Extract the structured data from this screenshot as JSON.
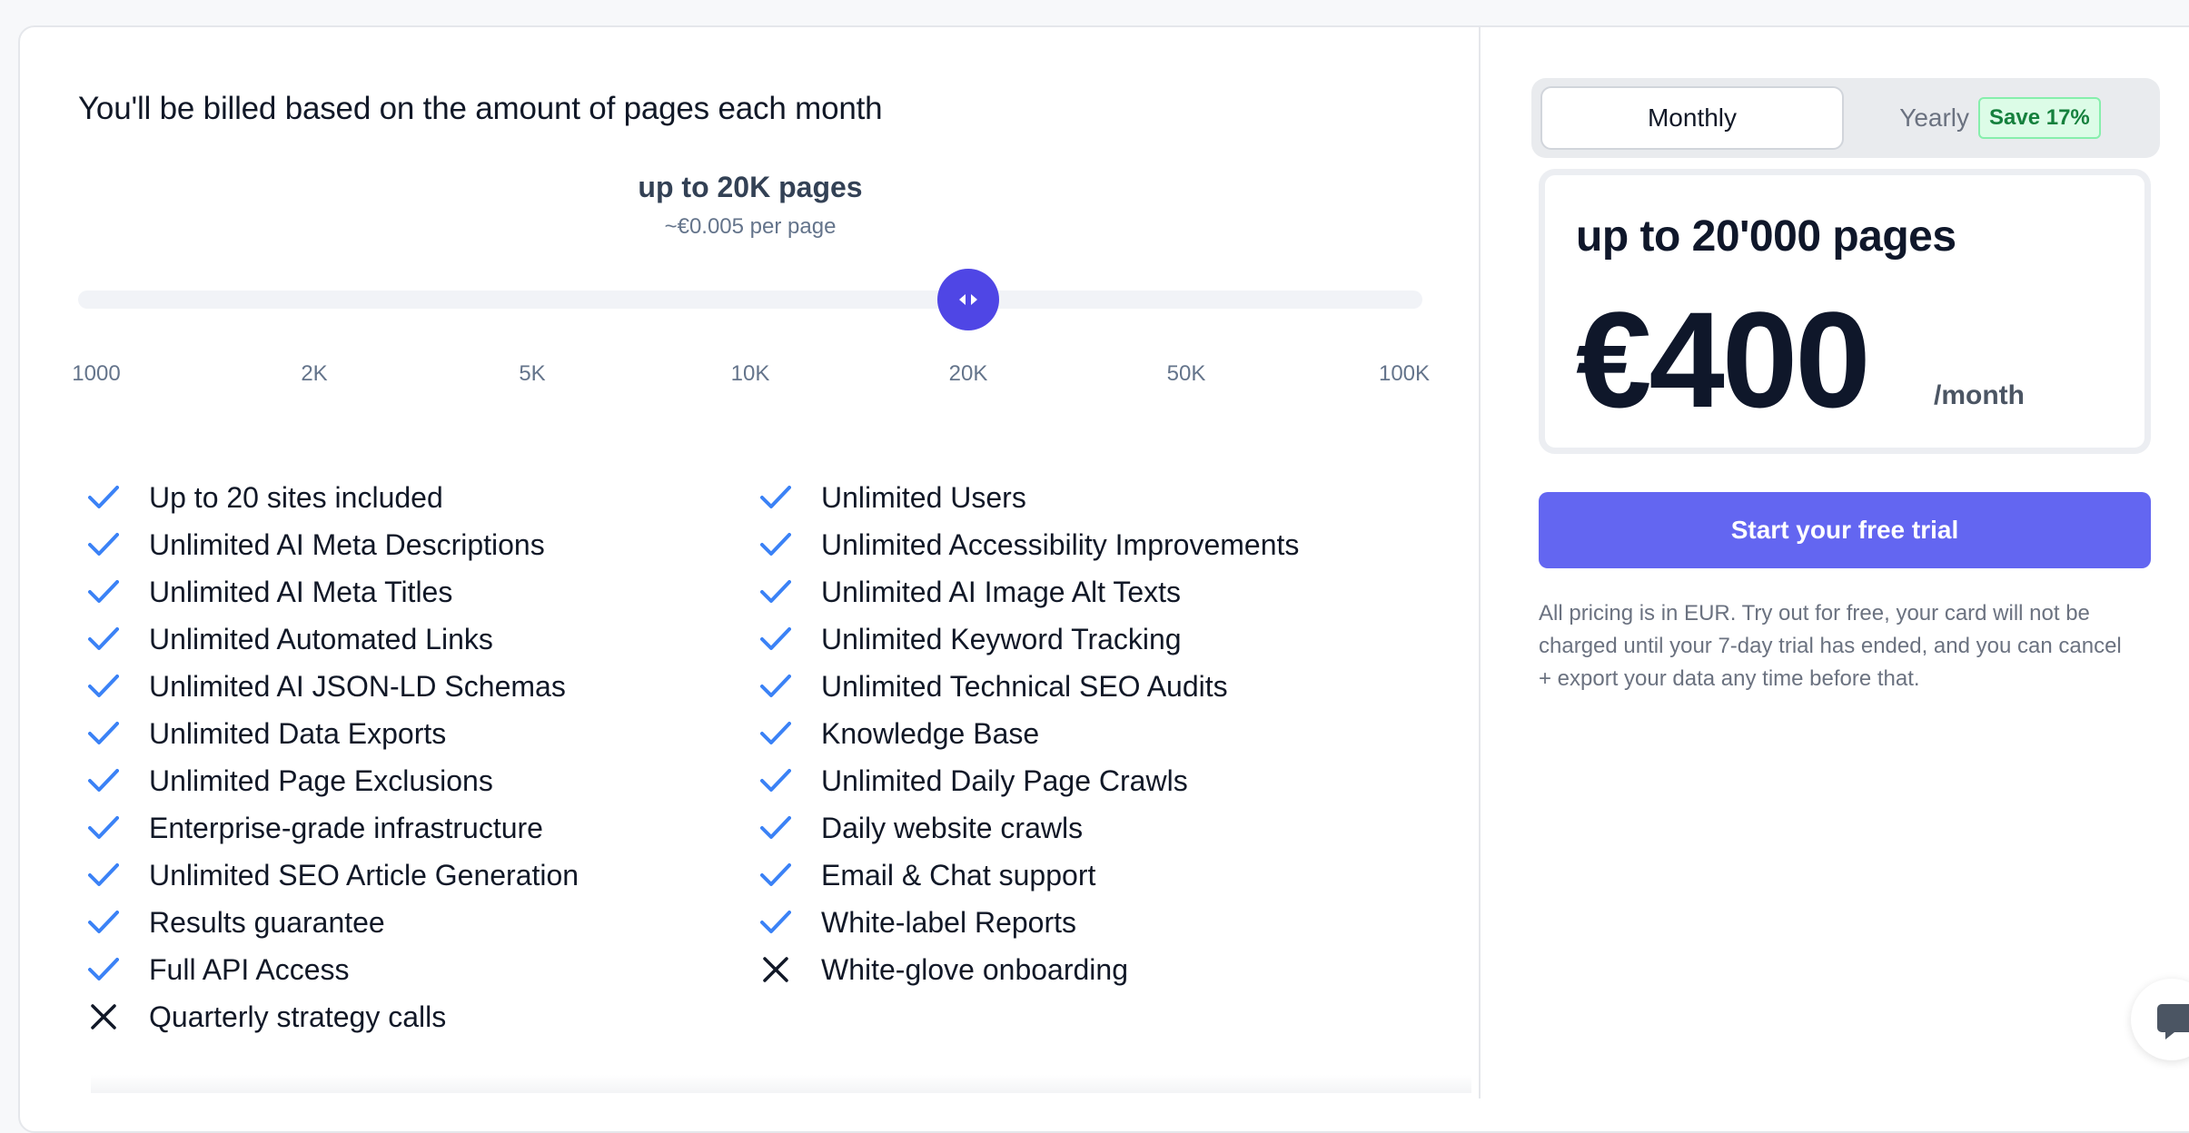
{
  "pricing": {
    "headline": "You'll be billed based on the amount of pages each month",
    "tier_title": "up to 20K pages",
    "tier_price_per_page": "~€0.005 per page",
    "slider": {
      "ticks": [
        "1000",
        "2K",
        "5K",
        "10K",
        "20K",
        "50K",
        "100K"
      ],
      "selected_index": 4
    }
  },
  "features": {
    "left": [
      {
        "label": "Up to 20 sites included",
        "included": true
      },
      {
        "label": "Unlimited AI Meta Descriptions",
        "included": true
      },
      {
        "label": "Unlimited AI Meta Titles",
        "included": true
      },
      {
        "label": "Unlimited Automated Links",
        "included": true
      },
      {
        "label": "Unlimited AI JSON-LD Schemas",
        "included": true
      },
      {
        "label": "Unlimited Data Exports",
        "included": true
      },
      {
        "label": "Unlimited Page Exclusions",
        "included": true
      },
      {
        "label": "Enterprise-grade infrastructure",
        "included": true
      },
      {
        "label": "Unlimited SEO Article Generation",
        "included": true
      },
      {
        "label": "Results guarantee",
        "included": true
      },
      {
        "label": "Full API Access",
        "included": true
      },
      {
        "label": "Quarterly strategy calls",
        "included": false
      }
    ],
    "right": [
      {
        "label": "Unlimited Users",
        "included": true
      },
      {
        "label": "Unlimited Accessibility Improvements",
        "included": true
      },
      {
        "label": "Unlimited AI Image Alt Texts",
        "included": true
      },
      {
        "label": "Unlimited Keyword Tracking",
        "included": true
      },
      {
        "label": "Unlimited Technical SEO Audits",
        "included": true
      },
      {
        "label": "Knowledge Base",
        "included": true
      },
      {
        "label": "Unlimited Daily Page Crawls",
        "included": true
      },
      {
        "label": "Daily website crawls",
        "included": true
      },
      {
        "label": "Email & Chat support",
        "included": true
      },
      {
        "label": "White-label Reports",
        "included": true
      },
      {
        "label": "White-glove onboarding",
        "included": false
      }
    ]
  },
  "billing": {
    "monthly_label": "Monthly",
    "yearly_label": "Yearly",
    "yearly_badge": "Save 17%",
    "selected": "monthly"
  },
  "price_card": {
    "pages": "up to 20'000 pages",
    "amount": "€400",
    "period": "/month"
  },
  "cta_label": "Start your free trial",
  "fine_print": "All pricing is in EUR. Try out for free, your card will not be charged until your 7-day trial has ended, and you can cancel + export your data any time before that.",
  "icons": {
    "check": "check-icon",
    "cross": "x-icon",
    "slider_thumb": "arrows-horizontal-icon",
    "chat": "chat-bubble-icon"
  },
  "colors": {
    "accent": "#6366f1",
    "slider_thumb": "#4f46e5",
    "check": "#3b82f6",
    "badge_bg": "#dcfce7",
    "badge_text": "#15803d"
  }
}
